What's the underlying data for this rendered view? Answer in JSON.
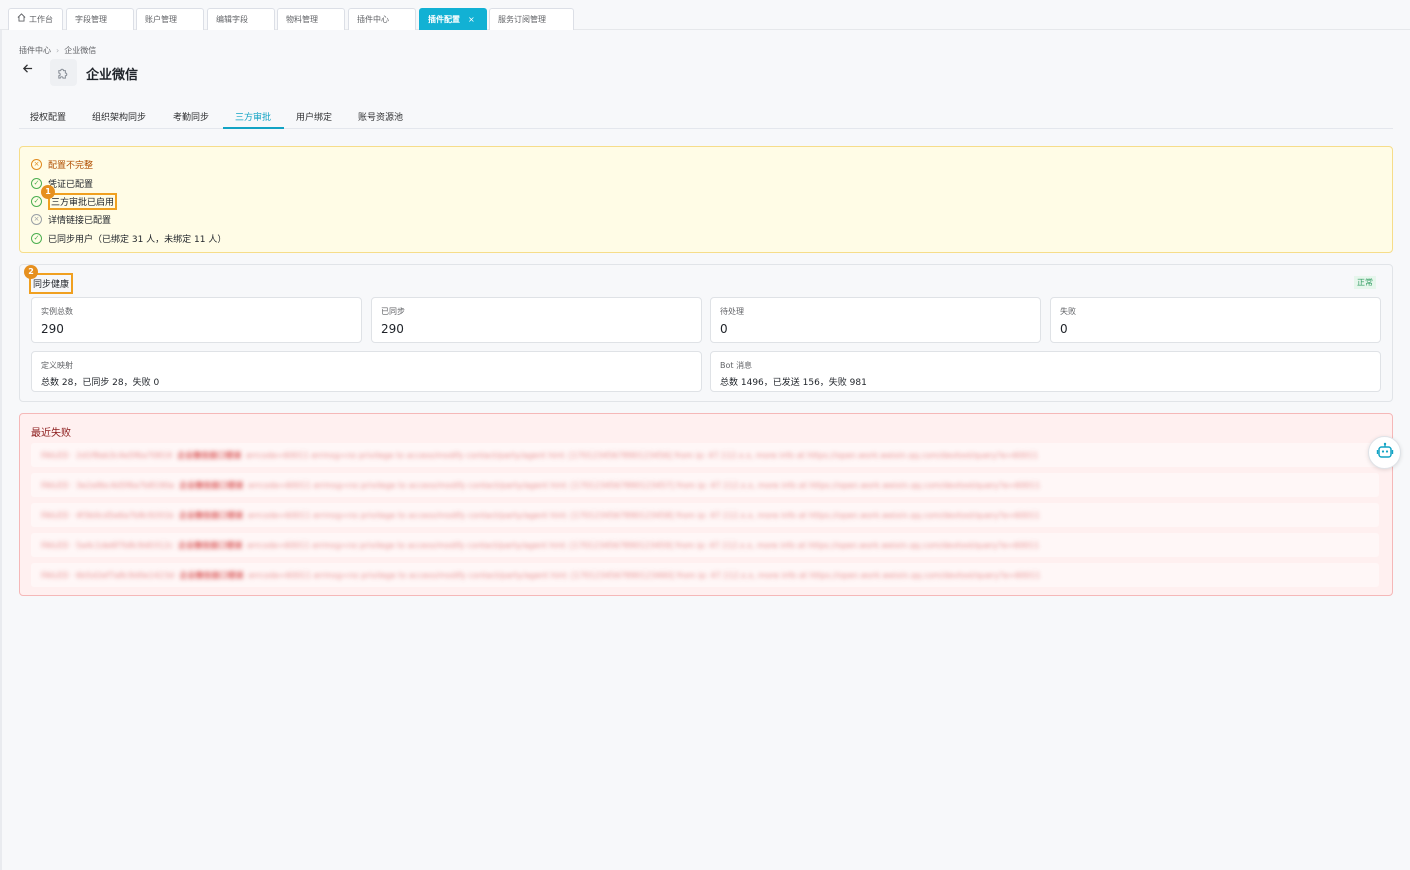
{
  "top_tabs": [
    {
      "label": "工作台"
    },
    {
      "label": "字段管理"
    },
    {
      "label": "账户管理"
    },
    {
      "label": "编辑字段"
    },
    {
      "label": "物料管理"
    },
    {
      "label": "插件中心"
    },
    {
      "label": "插件配置",
      "active": true
    },
    {
      "label": "服务订阅管理"
    }
  ],
  "breadcrumb": {
    "parent": "插件中心",
    "current": "企业微信"
  },
  "page": {
    "title": "企业微信",
    "icon": "plugin-icon"
  },
  "subtabs": [
    "授权配置",
    "组织架构同步",
    "考勤同步",
    "三方审批",
    "用户绑定",
    "账号资源池"
  ],
  "active_subtab": "三方审批",
  "checklist": {
    "title": "配置不完整",
    "items": [
      {
        "text": "凭证已配置",
        "status": "ok"
      },
      {
        "text": "三方审批已启用",
        "status": "ok"
      },
      {
        "text": "详情链接已配置",
        "status": "off"
      },
      {
        "text": "已同步用户（已绑定 31 人，未绑定 11 人）",
        "status": "ok"
      }
    ]
  },
  "annotations": [
    "1",
    "2"
  ],
  "health": {
    "title": "同步健康",
    "status": "正常",
    "stats": [
      {
        "label": "实例总数",
        "value": "290"
      },
      {
        "label": "已同步",
        "value": "290"
      },
      {
        "label": "待处理",
        "value": "0"
      },
      {
        "label": "失败",
        "value": "0"
      }
    ],
    "details": [
      {
        "label": "定义映射",
        "value": "总数 28，已同步 28，失败 0"
      },
      {
        "label": "Bot 消息",
        "value": "总数 1496，已发送 156，失败 981"
      }
    ]
  },
  "failures": {
    "title": "最近失败",
    "rows": [
      {
        "left": "FAILED · 2d1f8ab3c4e5f6a70819",
        "mid": "企业微信接口错误",
        "right": "errcode=60011 errmsg=no privilege to access/modify contact/party/agent hint: [1701234567890123456] from ip: 47.112.x.x, more info at https://open.work.weixin.qq.com/devtool/query?e=60011"
      },
      {
        "left": "FAILED · 3e2a9bc4d5f6a7b8190a",
        "mid": "企业微信接口错误",
        "right": "errcode=60011 errmsg=no privilege to access/modify contact/party/agent hint: [1701234567890123457] from ip: 47.112.x.x, more info at https://open.work.weixin.qq.com/devtool/query?e=60011"
      },
      {
        "left": "FAILED · 4f3b0cd5e6a7b8c9201b",
        "mid": "企业微信接口错误",
        "right": "errcode=60011 errmsg=no privilege to access/modify contact/party/agent hint: [1701234567890123458] from ip: 47.112.x.x, more info at https://open.work.weixin.qq.com/devtool/query?e=60011"
      },
      {
        "left": "FAILED · 5a4c1de6f7b8c9d0312c",
        "mid": "企业微信接口错误",
        "right": "errcode=60011 errmsg=no privilege to access/modify contact/party/agent hint: [1701234567890123459] from ip: 47.112.x.x, more info at https://open.work.weixin.qq.com/devtool/query?e=60011"
      },
      {
        "left": "FAILED · 6b5d2ef7a8c9d0e1423d",
        "mid": "企业微信接口错误",
        "right": "errcode=60011 errmsg=no privilege to access/modify contact/party/agent hint: [1701234567890123460] from ip: 47.112.x.x, more info at https://open.work.weixin.qq.com/devtool/query?e=60011"
      }
    ]
  },
  "floating": {
    "icon": "robot-icon"
  },
  "colors": {
    "accent": "#12b1d4",
    "warning_bg": "#fffce6",
    "error_bg": "#fff0f0",
    "ok": "#4caf50"
  }
}
